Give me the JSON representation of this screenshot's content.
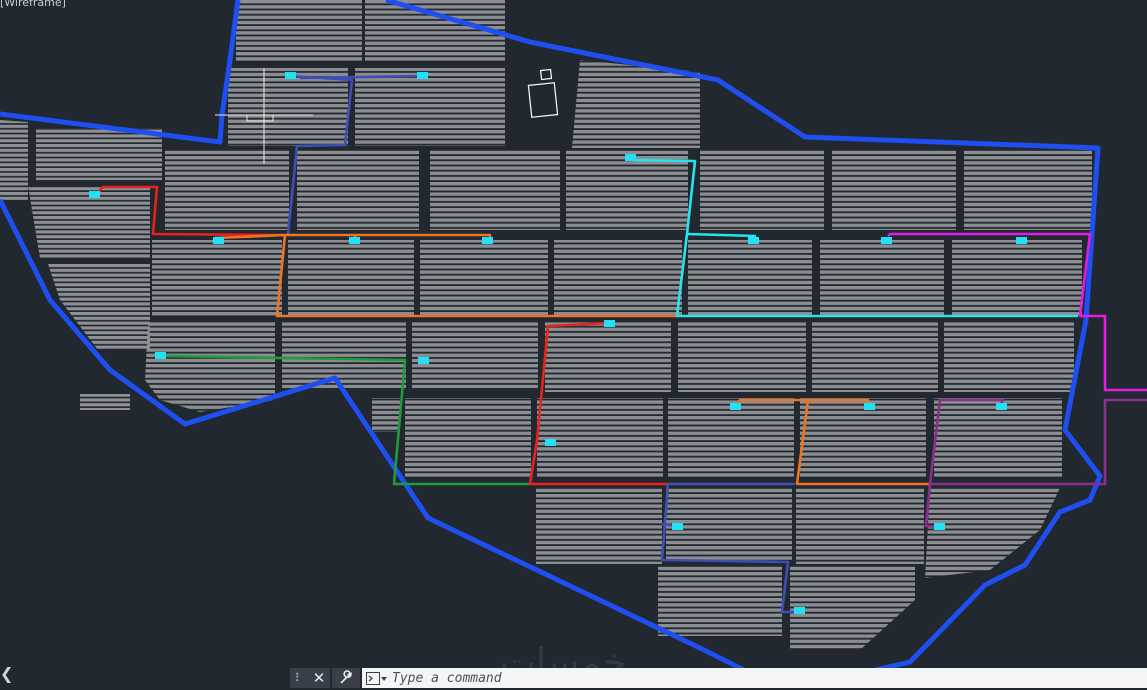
{
  "viewport": {
    "label": "[Wireframe]",
    "watermark": "خمسات"
  },
  "command_line": {
    "grip_icon": "grip-icon",
    "close_label": "✕",
    "customize_icon": "wrench-icon",
    "prompt_icon": "command-prompt-icon",
    "placeholder": "Type a command"
  },
  "colors": {
    "background": "#212830",
    "boundary": "#1f4ff0",
    "panel": "#8d8f93",
    "inverter": "#22e0f5",
    "cable_red": "#e8231b",
    "cable_orange": "#f0741f",
    "cable_cyan": "#27e3f0",
    "cable_magenta": "#e31ce3",
    "cable_green": "#1f9b3a",
    "cable_blue": "#3e4fb4",
    "cable_purple": "#8a2f8c",
    "crosshair": "#e9ebee"
  }
}
